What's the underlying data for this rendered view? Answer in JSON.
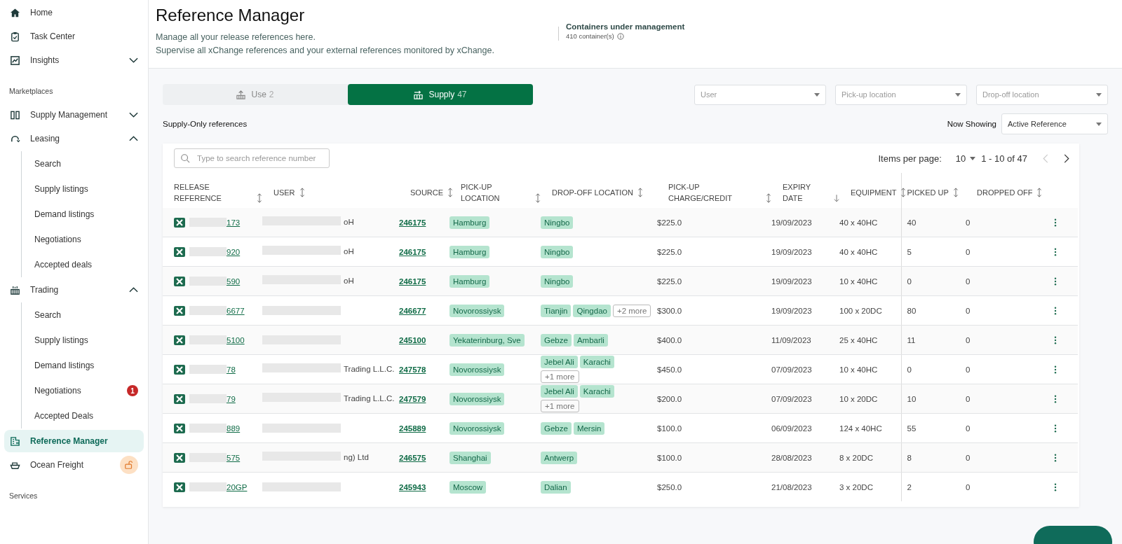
{
  "sidebar": {
    "items": [
      {
        "kind": "link",
        "label": "Home",
        "selected": false
      },
      {
        "kind": "link",
        "label": "Task Center",
        "selected": false
      },
      {
        "kind": "group",
        "label": "Insights",
        "expanded": false,
        "selected": false
      },
      {
        "kind": "section",
        "label": "Marketplaces"
      },
      {
        "kind": "group",
        "label": "Supply Management",
        "expanded": false,
        "selected": false
      },
      {
        "kind": "group",
        "label": "Leasing",
        "expanded": true,
        "selected": false,
        "children": [
          {
            "label": "Search"
          },
          {
            "label": "Supply listings"
          },
          {
            "label": "Demand listings"
          },
          {
            "label": "Negotiations"
          },
          {
            "label": "Accepted deals"
          }
        ]
      },
      {
        "kind": "group",
        "label": "Trading",
        "expanded": true,
        "selected": false,
        "children": [
          {
            "label": "Search"
          },
          {
            "label": "Supply listings"
          },
          {
            "label": "Demand listings"
          },
          {
            "label": "Negotiations",
            "badge": "1"
          },
          {
            "label": "Accepted Deals"
          }
        ]
      },
      {
        "kind": "link",
        "label": "Reference Manager",
        "selected": true
      },
      {
        "kind": "link",
        "label": "Ocean Freight",
        "locked": true,
        "selected": false
      },
      {
        "kind": "section",
        "label": "Services"
      }
    ]
  },
  "header": {
    "title": "Reference Manager",
    "subtitle_lines": [
      "Manage all your release references here.",
      "Supervise all xChange references and your external references monitored by xChange."
    ],
    "stat": {
      "label": "Containers under management",
      "value": "410 container(s)"
    }
  },
  "tabs": [
    {
      "label": "Use",
      "count": "2",
      "selected": false
    },
    {
      "label": "Supply",
      "count": "47",
      "selected": true
    }
  ],
  "filters": [
    {
      "placeholder": "User"
    },
    {
      "placeholder": "Pick-up location"
    },
    {
      "placeholder": "Drop-off location"
    }
  ],
  "section_title": "Supply-Only references",
  "now_showing": {
    "label": "Now Showing",
    "value": "Active Reference"
  },
  "table": {
    "search": {
      "placeholder": "Type to search reference number"
    },
    "pagination": {
      "label": "Items per page:",
      "per_page": "10",
      "range": "1 - 10 of 47"
    },
    "columns": [
      {
        "label": "RELEASE REFERENCE"
      },
      {
        "label": "USER"
      },
      {
        "label": "SOURCE"
      },
      {
        "label": "PICK-UP LOCATION"
      },
      {
        "label": "DROP-OFF LOCATION"
      },
      {
        "label": "PICK-UP CHARGE/CREDIT"
      },
      {
        "label": "EXPIRY DATE"
      },
      {
        "label": "EQUIPMENT"
      },
      {
        "label": "PICKED UP"
      },
      {
        "label": "DROPPED OFF"
      }
    ],
    "rows": [
      {
        "reference": "173",
        "user": "oH",
        "source": "246175",
        "pickup": "Hamburg",
        "dropoff": [
          "Ningbo"
        ],
        "charge": "$225.0",
        "expiry": "19/09/2023",
        "equipment": "40 x 40HC",
        "picked_up": "40",
        "dropped_off": "0"
      },
      {
        "reference": "920",
        "user": "oH",
        "source": "246175",
        "pickup": "Hamburg",
        "dropoff": [
          "Ningbo"
        ],
        "charge": "$225.0",
        "expiry": "19/09/2023",
        "equipment": "40 x 40HC",
        "picked_up": "5",
        "dropped_off": "0"
      },
      {
        "reference": "590",
        "user": "oH",
        "source": "246175",
        "pickup": "Hamburg",
        "dropoff": [
          "Ningbo"
        ],
        "charge": "$225.0",
        "expiry": "19/09/2023",
        "equipment": "10 x 40HC",
        "picked_up": "0",
        "dropped_off": "0"
      },
      {
        "reference": "6677",
        "source": "246677",
        "pickup": "Novorossiysk",
        "dropoff": [
          "Tianjin",
          "Qingdao"
        ],
        "more": "+2 more",
        "charge": "$300.0",
        "expiry": "19/09/2023",
        "equipment": "100 x 20DC",
        "picked_up": "80",
        "dropped_off": "0"
      },
      {
        "reference": "5100",
        "source": "245100",
        "pickup": "Yekaterinburg, Sve",
        "dropoff": [
          "Gebze",
          "Ambarli"
        ],
        "charge": "$400.0",
        "expiry": "11/09/2023",
        "equipment": "25 x 40HC",
        "picked_up": "11",
        "dropped_off": "0"
      },
      {
        "reference": "78",
        "user": "Trading L.L.C.",
        "source": "247578",
        "pickup": "Novorossiysk",
        "dropoff": [
          "Jebel Ali",
          "Karachi"
        ],
        "more": "+1 more",
        "charge": "$450.0",
        "expiry": "07/09/2023",
        "equipment": "10 x 40HC",
        "picked_up": "0",
        "dropped_off": "0"
      },
      {
        "reference": "79",
        "user": "Trading L.L.C.",
        "source": "247579",
        "pickup": "Novorossiysk",
        "dropoff": [
          "Jebel Ali",
          "Karachi"
        ],
        "more": "+1 more",
        "charge": "$200.0",
        "expiry": "07/09/2023",
        "equipment": "10 x 20DC",
        "picked_up": "10",
        "dropped_off": "0"
      },
      {
        "reference": "889",
        "source": "245889",
        "pickup": "Novorossiysk",
        "dropoff": [
          "Gebze",
          "Mersin"
        ],
        "charge": "$100.0",
        "expiry": "06/09/2023",
        "equipment": "124 x 40HC",
        "picked_up": "55",
        "dropped_off": "0"
      },
      {
        "reference": "575",
        "user": "ng) Ltd",
        "source": "246575",
        "pickup": "Shanghai",
        "dropoff": [
          "Antwerp"
        ],
        "charge": "$100.0",
        "expiry": "28/08/2023",
        "equipment": "8 x 20DC",
        "picked_up": "8",
        "dropped_off": "0"
      },
      {
        "reference": "20GP",
        "source": "245943",
        "pickup": "Moscow",
        "dropoff": [
          "Dalian"
        ],
        "charge": "$250.0",
        "expiry": "21/08/2023",
        "equipment": "3 x 20DC",
        "picked_up": "2",
        "dropped_off": "0"
      }
    ]
  }
}
